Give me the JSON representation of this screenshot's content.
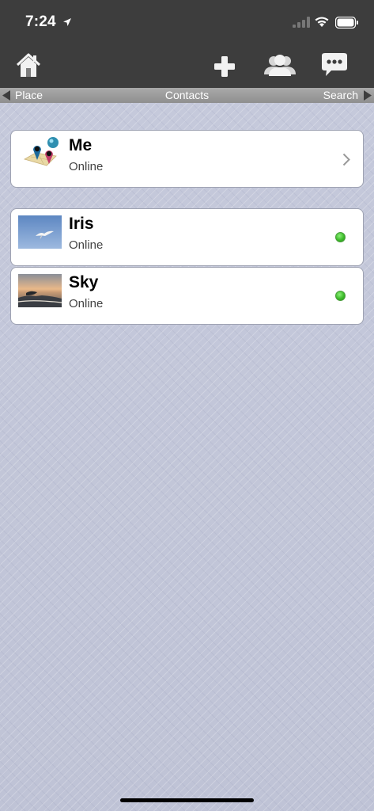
{
  "status_bar": {
    "time": "7:24",
    "icons": [
      "location-arrow-icon",
      "signal-icon",
      "wifi-icon",
      "battery-icon"
    ]
  },
  "nav_bar": {
    "icons": [
      "home-icon",
      "add-icon",
      "group-icon",
      "chat-icon"
    ]
  },
  "tabs": {
    "left": "Place",
    "center": "Contacts",
    "right": "Search"
  },
  "me": {
    "name": "Me",
    "status": "Online"
  },
  "contacts": [
    {
      "name": "Iris",
      "status": "Online",
      "online_color": "#3dbb2a"
    },
    {
      "name": "Sky",
      "status": "Online",
      "online_color": "#3dbb2a"
    }
  ],
  "colors": {
    "bar_background": "#3d3d3d",
    "tab_strip": "#9a9a9a",
    "page_background": "#c3c7da",
    "card_background": "#ffffff"
  }
}
